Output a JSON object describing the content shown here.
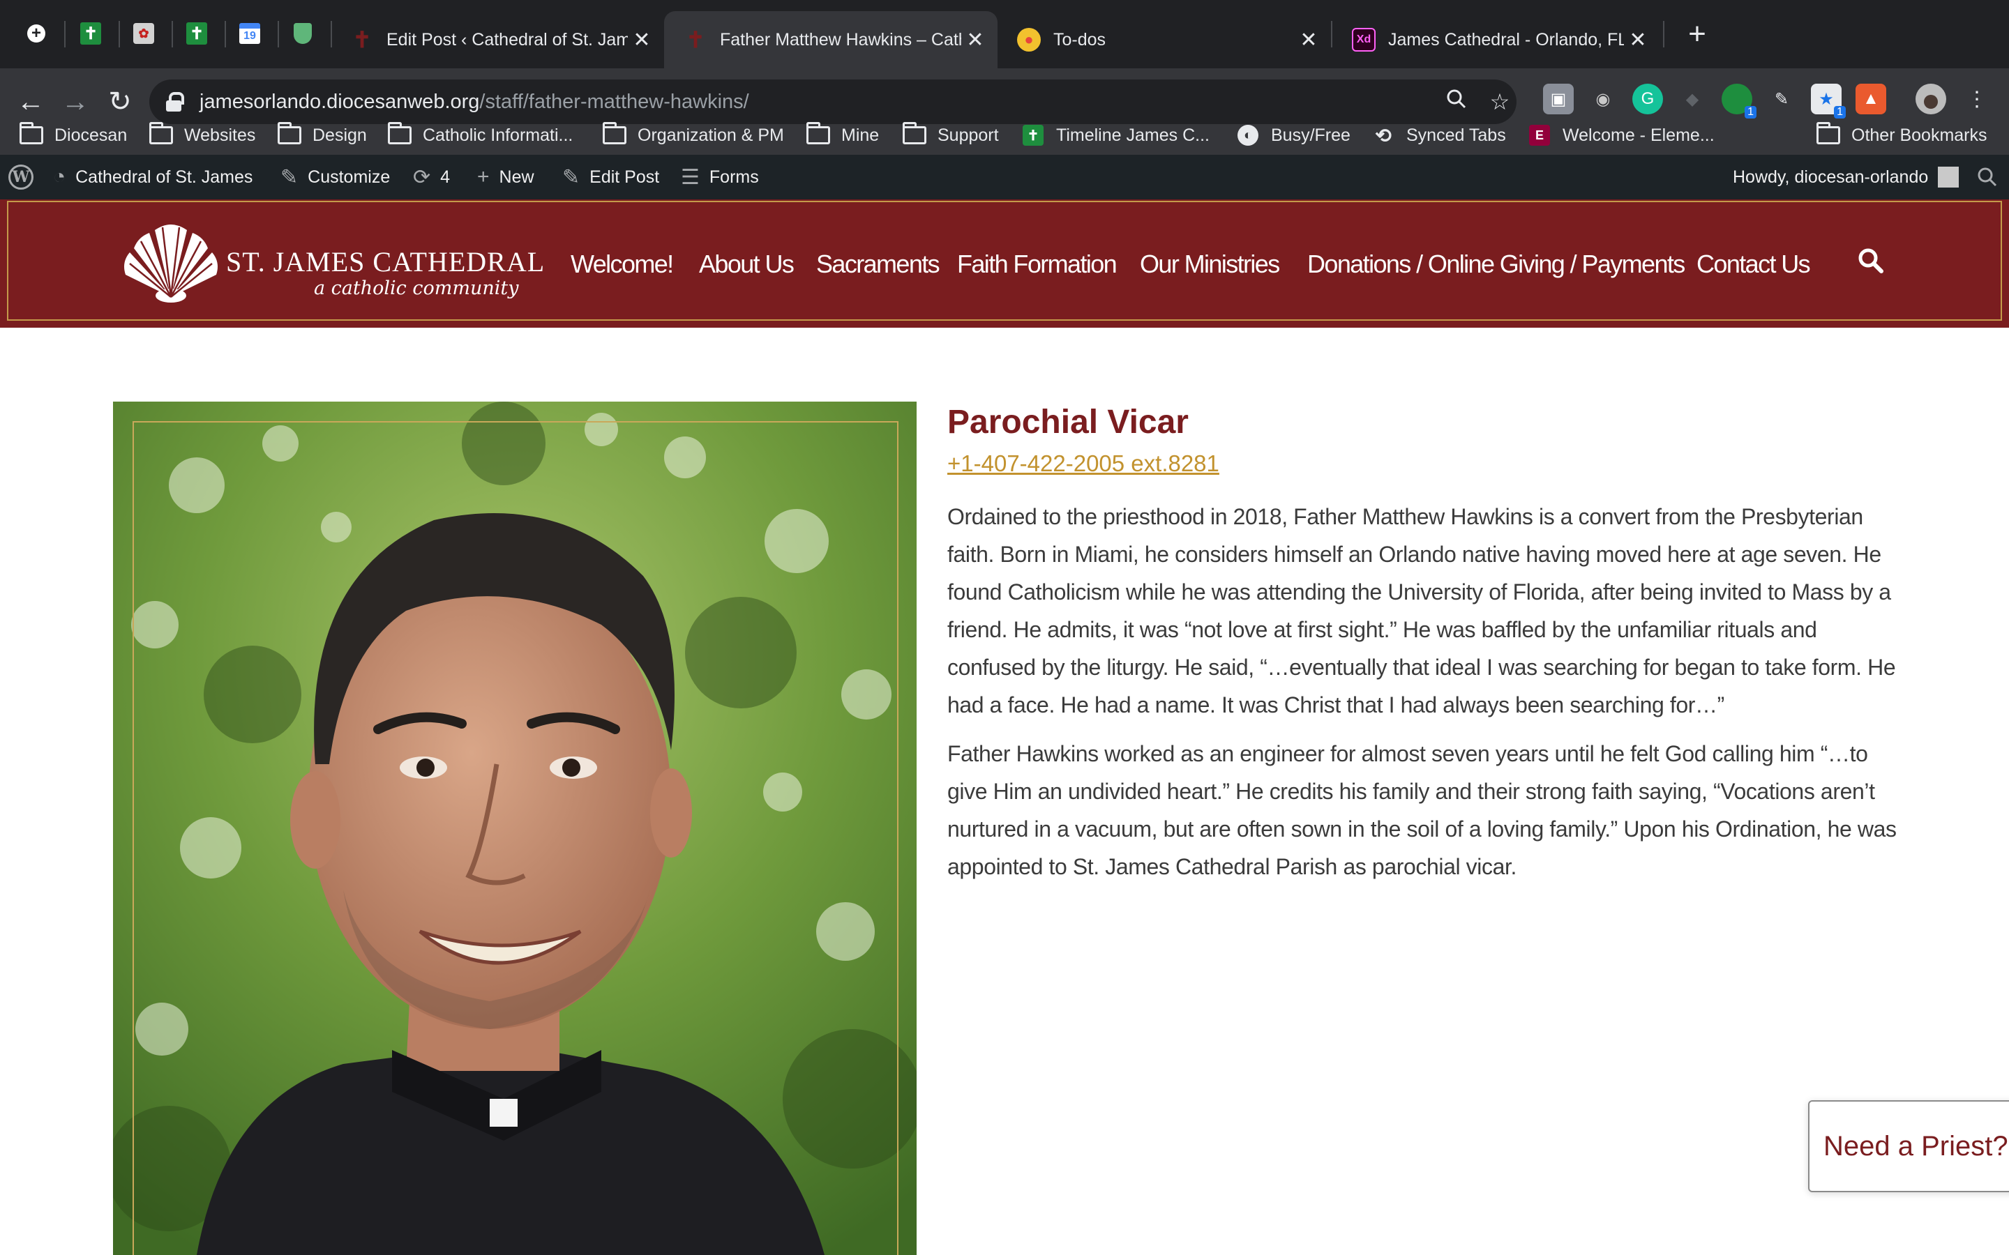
{
  "browser": {
    "pinned_tabs": [
      {
        "icon": "new-page-icon"
      },
      {
        "icon": "cross-green-icon"
      },
      {
        "icon": "puzzle-icon"
      },
      {
        "icon": "cross-green-icon"
      },
      {
        "icon": "calendar-icon",
        "text": "19"
      },
      {
        "icon": "shield-green-icon"
      }
    ],
    "tabs": [
      {
        "label": "Edit Post ‹ Cathedral of St. James",
        "close": "✕",
        "active": false
      },
      {
        "label": "Father Matthew Hawkins – Cathedral of St. James",
        "close": "✕",
        "active": true
      },
      {
        "label": "To-dos",
        "close": "✕",
        "active": false
      },
      {
        "label": "James Cathedral - Orlando, FL",
        "close": "✕",
        "active": false
      }
    ],
    "new_tab": "+",
    "url_host": "jamesorlando.diocesanweb.org",
    "url_path": "/staff/father-matthew-hawkins/",
    "bookmarks": [
      {
        "label": "Diocesan",
        "type": "folder"
      },
      {
        "label": "Websites",
        "type": "folder"
      },
      {
        "label": "Design",
        "type": "folder"
      },
      {
        "label": "Catholic Informati...",
        "type": "folder"
      },
      {
        "label": "Organization & PM",
        "type": "folder"
      },
      {
        "label": "Mine",
        "type": "folder"
      },
      {
        "label": "Support",
        "type": "folder"
      },
      {
        "label": "Timeline James C...",
        "type": "sheet"
      },
      {
        "label": "Busy/Free",
        "type": "globe"
      },
      {
        "label": "Synced Tabs",
        "type": "history"
      },
      {
        "label": "Welcome - Eleme...",
        "type": "elementor"
      }
    ],
    "other_bookmarks": "Other Bookmarks",
    "extension_badges": [
      "1",
      "1"
    ]
  },
  "wp_admin": {
    "site_name": "Cathedral of St. James",
    "customize": "Customize",
    "updates_count": "4",
    "new": "New",
    "edit_post": "Edit Post",
    "forms": "Forms",
    "howdy": "Howdy, diocesan-orlando"
  },
  "site": {
    "logo_name": "ST. JAMES CATHEDRAL",
    "logo_tagline": "a catholic community",
    "nav": [
      "Welcome!",
      "About Us",
      "Sacraments",
      "Faith Formation",
      "Our Ministries",
      "Donations / Online Giving / Payments",
      "Contact Us"
    ],
    "colors": {
      "brand": "#7a1d1f",
      "gold": "#c39a4a"
    }
  },
  "staff": {
    "role": "Parochial Vicar",
    "phone": "+1-407-422-2005 ext.8281",
    "bio_paragraphs": [
      "Ordained to the priesthood in 2018, Father Matthew Hawkins is a convert from the Presbyterian faith. Born in Miami, he considers himself an Orlando native having moved here at age seven. He found Catholicism while he was attending the University of Florida, after being invited to Mass by a friend. He admits, it was “not love at first sight.” He was baffled by the unfamiliar rituals and confused by the liturgy. He said, “…eventually that ideal I was searching for began to take form. He had a face. He had a name. It was Christ that I had always been searching for…”",
      "Father Hawkins worked as an engineer for almost seven years until he felt God calling him “…to give Him an undivided heart.” He credits his family and their strong faith saying, “Vocations aren’t nurtured in a vacuum, but are often sown in the soil of a loving family.” Upon his Ordination, he was appointed to St. James Cathedral Parish as parochial vicar."
    ]
  },
  "need_priest": "Need a Priest?"
}
